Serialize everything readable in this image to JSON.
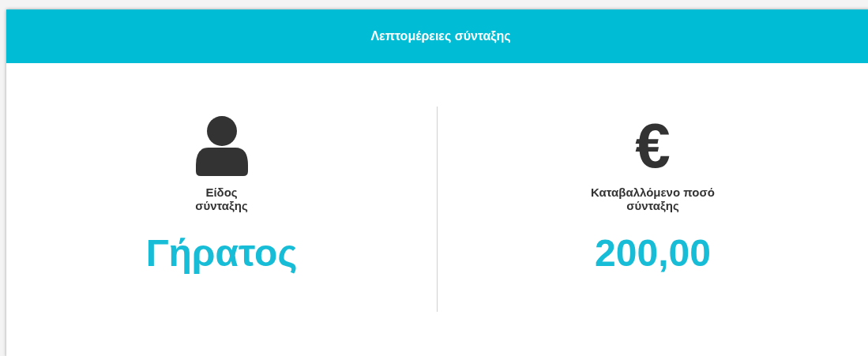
{
  "card": {
    "title": "Λεπτομέρειες σύνταξης",
    "items": [
      {
        "kind": "person",
        "label_lines": [
          "Είδος",
          "σύνταξης"
        ],
        "value": "Γήρατος"
      },
      {
        "kind": "glyph",
        "glyph": "€",
        "label_lines": [
          "Καταβαλλόμενο ποσό",
          "σύνταξης"
        ],
        "value": "200,00"
      }
    ]
  }
}
